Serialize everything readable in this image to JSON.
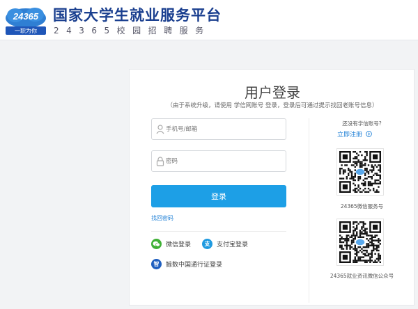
{
  "header": {
    "logo_number": "24365",
    "logo_slogan": "一职为你",
    "title": "国家大学生就业服务平台",
    "subtitle": "24365校园招聘服务"
  },
  "login": {
    "title": "用户登录",
    "notice": "（由于系统升级，请使用 学信网账号 登录，登录后可通过提示找回老账号信息）",
    "username_placeholder": "手机号/邮箱",
    "password_placeholder": "密码",
    "submit_label": "登录",
    "forgot_label": "找回密码"
  },
  "social": [
    {
      "label": "微信登录",
      "icon": "wechat-icon"
    },
    {
      "label": "支付宝登录",
      "icon": "alipay-icon",
      "glyph": "支"
    },
    {
      "label": "鲸数中国通行证登录",
      "icon": "gov-pass-icon",
      "glyph": "智"
    }
  ],
  "register": {
    "question": "还没有学信账号?",
    "link_label": "立即注册"
  },
  "qrcodes": [
    {
      "label": "24365微信服务号"
    },
    {
      "label": "24365就业资讯微信公众号"
    }
  ],
  "colors": {
    "primary": "#1d9fe6",
    "link": "#1d7fd6",
    "brand_title": "#1a3f8f",
    "wechat": "#3eb035",
    "alipay": "#1e9ae0",
    "gov": "#1f5fbf"
  }
}
